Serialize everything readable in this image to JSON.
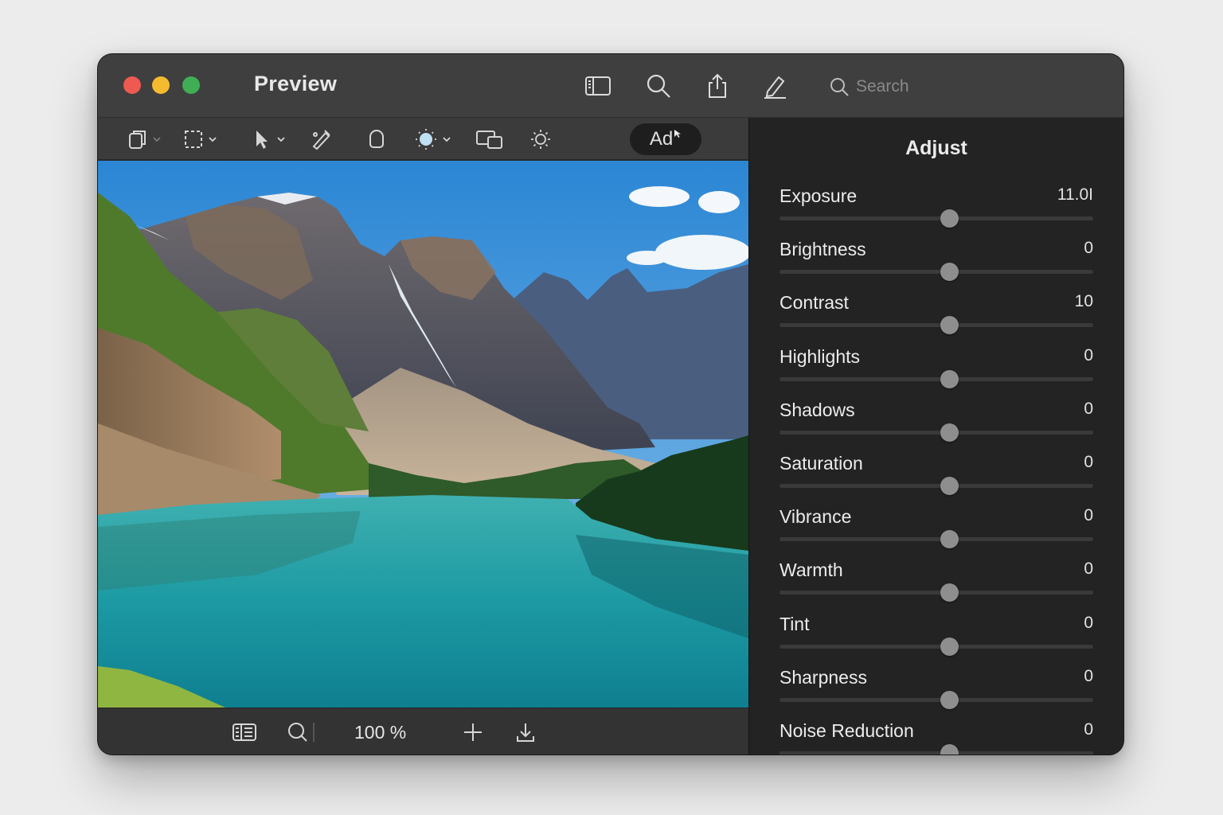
{
  "window": {
    "title": "Preview",
    "search_placeholder": "Search"
  },
  "titlebar_icons": [
    "sidebar-icon",
    "zoom-icon",
    "share-icon",
    "markup-icon"
  ],
  "toolbar": {
    "tools": [
      "page-copy-icon",
      "rectangular-selection-icon",
      "pointer-icon",
      "sketch-icon",
      "shape-icon",
      "adjust-color-icon",
      "resize-icon",
      "brightness-icon"
    ],
    "text_tool_label": "Ad"
  },
  "bottombar": {
    "zoom": "100 %",
    "icons": [
      "sidebar-list-icon",
      "zoom-out-icon",
      "zoom-in-icon",
      "download-icon"
    ]
  },
  "adjust": {
    "title": "Adjust",
    "rows": [
      {
        "label": "Exposure",
        "value": "11.0I",
        "level": 0.54
      },
      {
        "label": "Brightness",
        "value": "0",
        "level": 0.54
      },
      {
        "label": "Contrast",
        "value": "10",
        "level": 0.54
      },
      {
        "label": "Highlights",
        "value": "0",
        "level": 0.54
      },
      {
        "label": "Shadows",
        "value": "0",
        "level": 0.54
      },
      {
        "label": "Saturation",
        "value": "0",
        "level": 0.54
      },
      {
        "label": "Vibrance",
        "value": "0",
        "level": 0.54
      },
      {
        "label": "Warmth",
        "value": "0",
        "level": 0.54
      },
      {
        "label": "Tint",
        "value": "0",
        "level": 0.54
      },
      {
        "label": "Sharpness",
        "value": "0",
        "level": 0.54
      },
      {
        "label": "Noise Reduction",
        "value": "0",
        "level": 0.54
      }
    ]
  },
  "colors": {
    "close": "#ee5a52",
    "minimize": "#f5bb2e",
    "zoom": "#3fae55"
  }
}
